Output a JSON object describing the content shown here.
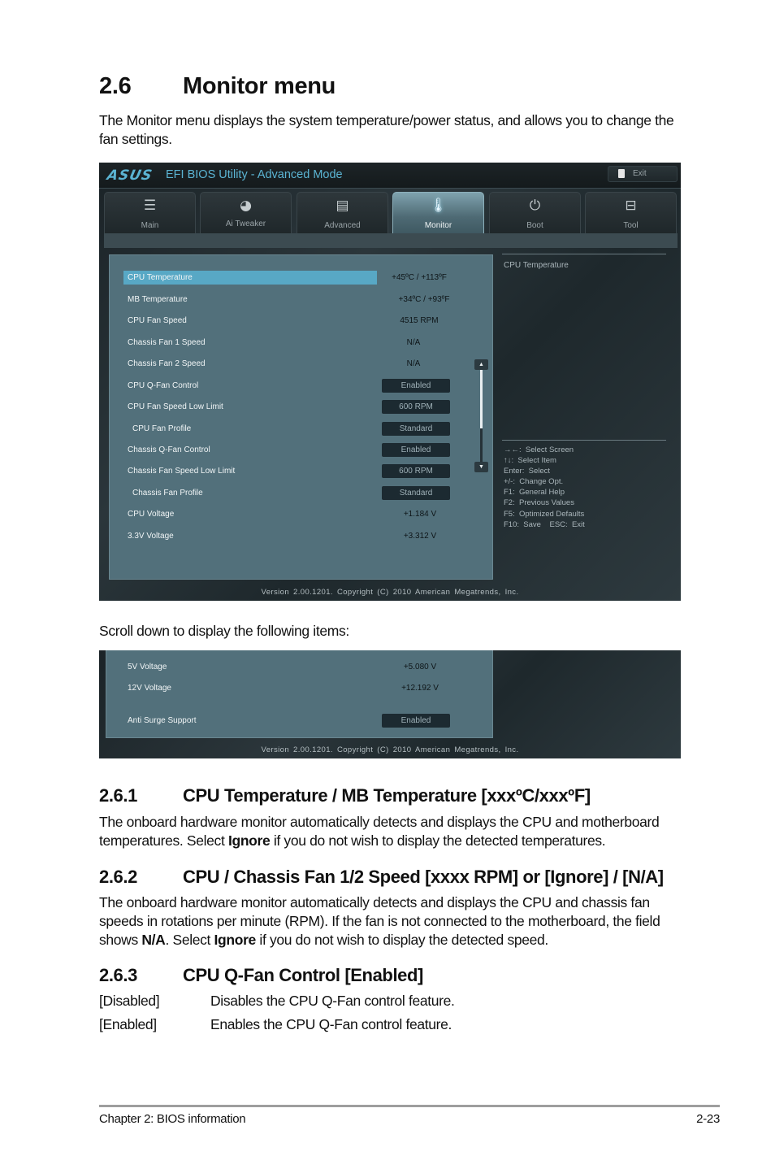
{
  "section": {
    "number": "2.6",
    "title": "Monitor menu",
    "intro": "The Monitor menu displays the system temperature/power status, and allows you to change the fan settings."
  },
  "bios": {
    "brand": "ASUS",
    "title": "EFI BIOS Utility - Advanced Mode",
    "exit_label": "Exit",
    "tabs": [
      {
        "label": "Main",
        "icon": "list-icon",
        "glyph": "☰"
      },
      {
        "label": "Ai  Tweaker",
        "icon": "tweaker-icon",
        "glyph": "◕"
      },
      {
        "label": "Advanced",
        "icon": "advanced-icon",
        "glyph": "▤"
      },
      {
        "label": "Monitor",
        "icon": "thermometer-icon",
        "glyph": "🌡",
        "active": true
      },
      {
        "label": "Boot",
        "icon": "power-icon",
        "glyph": "⏻"
      },
      {
        "label": "Tool",
        "icon": "toolbox-icon",
        "glyph": "⊟"
      }
    ],
    "items": [
      {
        "label": "CPU Temperature",
        "value": "+45ºC / +113ºF",
        "type": "readout",
        "selected": true
      },
      {
        "label": "MB Temperature",
        "value": "+34ºC / +93ºF",
        "type": "readout"
      },
      {
        "label": "CPU Fan Speed",
        "value": "4515 RPM",
        "type": "readout"
      },
      {
        "label": "Chassis Fan 1 Speed",
        "value": "N/A",
        "type": "readout"
      },
      {
        "label": "Chassis Fan 2 Speed",
        "value": "N/A",
        "type": "readout"
      },
      {
        "label": "CPU Q-Fan Control",
        "value": "Enabled",
        "type": "option"
      },
      {
        "label": "CPU Fan Speed Low Limit",
        "value": "600 RPM",
        "type": "option"
      },
      {
        "label": "CPU Fan Profile",
        "value": "Standard",
        "type": "option",
        "indent": true
      },
      {
        "label": "Chassis Q-Fan Control",
        "value": "Enabled",
        "type": "option"
      },
      {
        "label": "Chassis Fan Speed Low Limit",
        "value": "600 RPM",
        "type": "option"
      },
      {
        "label": "Chassis Fan Profile",
        "value": "Standard",
        "type": "option",
        "indent": true
      },
      {
        "label": "CPU Voltage",
        "value": "+1.184 V",
        "type": "readout"
      },
      {
        "label": "3.3V Voltage",
        "value": "+3.312 V",
        "type": "readout"
      }
    ],
    "scroll_position_fraction": 0.0,
    "side_title": "CPU Temperature",
    "help": [
      "→←:  Select Screen",
      "↑↓:  Select Item",
      "Enter:  Select",
      "+/-:  Change Opt.",
      "F1:  General Help",
      "F2:  Previous Values",
      "F5:  Optimized Defaults",
      "F10:  Save    ESC:  Exit"
    ],
    "version": "Version  2.00.1201.  Copyright  (C)  2010  American  Megatrends,  Inc."
  },
  "scroll_note": "Scroll down to display the following items:",
  "bios2": {
    "items": [
      {
        "label": "5V Voltage",
        "value": "+5.080 V",
        "type": "readout"
      },
      {
        "label": "12V Voltage",
        "value": "+12.192 V",
        "type": "readout"
      },
      {
        "label": "Anti Surge Support",
        "value": "Enabled",
        "type": "option"
      }
    ],
    "version": "Version  2.00.1201.  Copyright  (C)  2010  American  Megatrends,  Inc."
  },
  "subsections": [
    {
      "number": "2.6.1",
      "title": "CPU Temperature / MB Temperature [xxxºC/xxxºF]",
      "text_before": "The onboard hardware monitor automatically detects and displays the CPU and motherboard temperatures. Select ",
      "bold1": "Ignore",
      "text_after": " if you do not wish to display the detected temperatures."
    },
    {
      "number": "2.6.2",
      "title": "CPU / Chassis Fan 1/2 Speed [xxxx RPM] or [Ignore] / [N/A]",
      "text_before": "The onboard hardware monitor automatically detects and displays the CPU and chassis fan speeds in rotations per minute (RPM). If the fan is not connected to the motherboard, the field shows ",
      "bold1": "N/A",
      "text_mid": ". Select ",
      "bold2": "Ignore",
      "text_after": " if you do not wish to display the detected speed."
    },
    {
      "number": "2.6.3",
      "title": "CPU Q-Fan Control [Enabled]",
      "definitions": [
        {
          "term": "[Disabled]",
          "desc": "Disables the CPU Q-Fan control feature."
        },
        {
          "term": "[Enabled]",
          "desc": "Enables the CPU Q-Fan control feature."
        }
      ]
    }
  ],
  "footer": {
    "chapter": "Chapter 2: BIOS information",
    "page": "2-23"
  }
}
